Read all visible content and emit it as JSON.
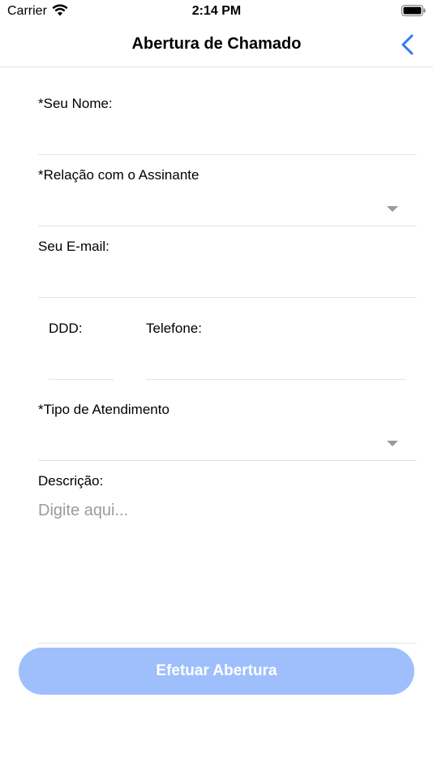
{
  "status_bar": {
    "carrier": "Carrier",
    "time": "2:14 PM",
    "icons": [
      "wifi-icon",
      "battery-icon"
    ]
  },
  "nav": {
    "title": "Abertura de Chamado",
    "back_icon": "chevron-left-icon",
    "accent_color": "#2f7bf6"
  },
  "form": {
    "name_label": "*Seu Nome:",
    "name_value": "",
    "relation_label": "*Relação com o Assinante",
    "relation_value": "",
    "email_label": "Seu E-mail:",
    "email_value": "",
    "ddd_label": "DDD:",
    "ddd_value": "",
    "phone_label": "Telefone:",
    "phone_value": "",
    "service_type_label": "*Tipo de Atendimento",
    "service_type_value": "",
    "description_label": "Descrição:",
    "description_placeholder": "Digite aqui...",
    "description_value": ""
  },
  "submit": {
    "label": "Efetuar Abertura",
    "color": "#9ebffc"
  }
}
